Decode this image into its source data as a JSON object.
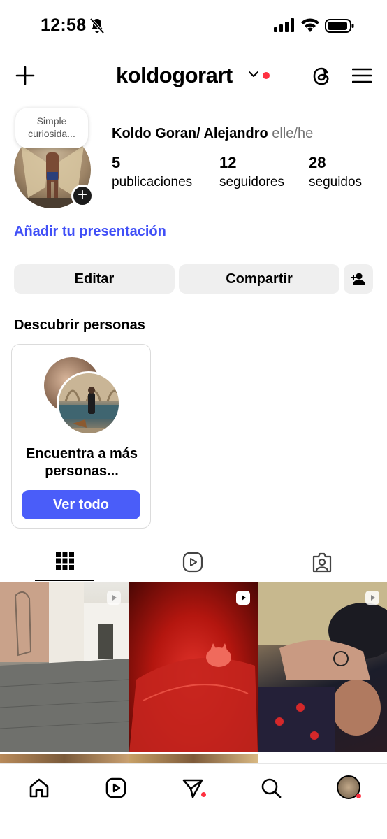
{
  "status_bar": {
    "time": "12:58"
  },
  "header": {
    "username": "koldogorart"
  },
  "profile": {
    "note": "Simple curiosida...",
    "full_name": "Koldo Goran/ Alejandro",
    "pronouns": "elle/he",
    "stats": [
      {
        "value": "5",
        "label": "publicaciones"
      },
      {
        "value": "12",
        "label": "seguidores"
      },
      {
        "value": "28",
        "label": "seguidos"
      }
    ],
    "bio_link": "Añadir tu presentación"
  },
  "actions": {
    "edit": "Editar",
    "share": "Compartir"
  },
  "discover": {
    "title": "Descubrir personas",
    "card_text": "Encuentra a más personas...",
    "card_button": "Ver todo"
  },
  "colors": {
    "accent": "#4a5df9",
    "link": "#4150f7",
    "notification": "#ff3040"
  },
  "tabs": [
    "grid-icon",
    "reels-icon",
    "tagged-icon"
  ],
  "bottom_nav": [
    "home-icon",
    "reels-icon",
    "direct-icon",
    "search-icon",
    "profile-avatar"
  ]
}
